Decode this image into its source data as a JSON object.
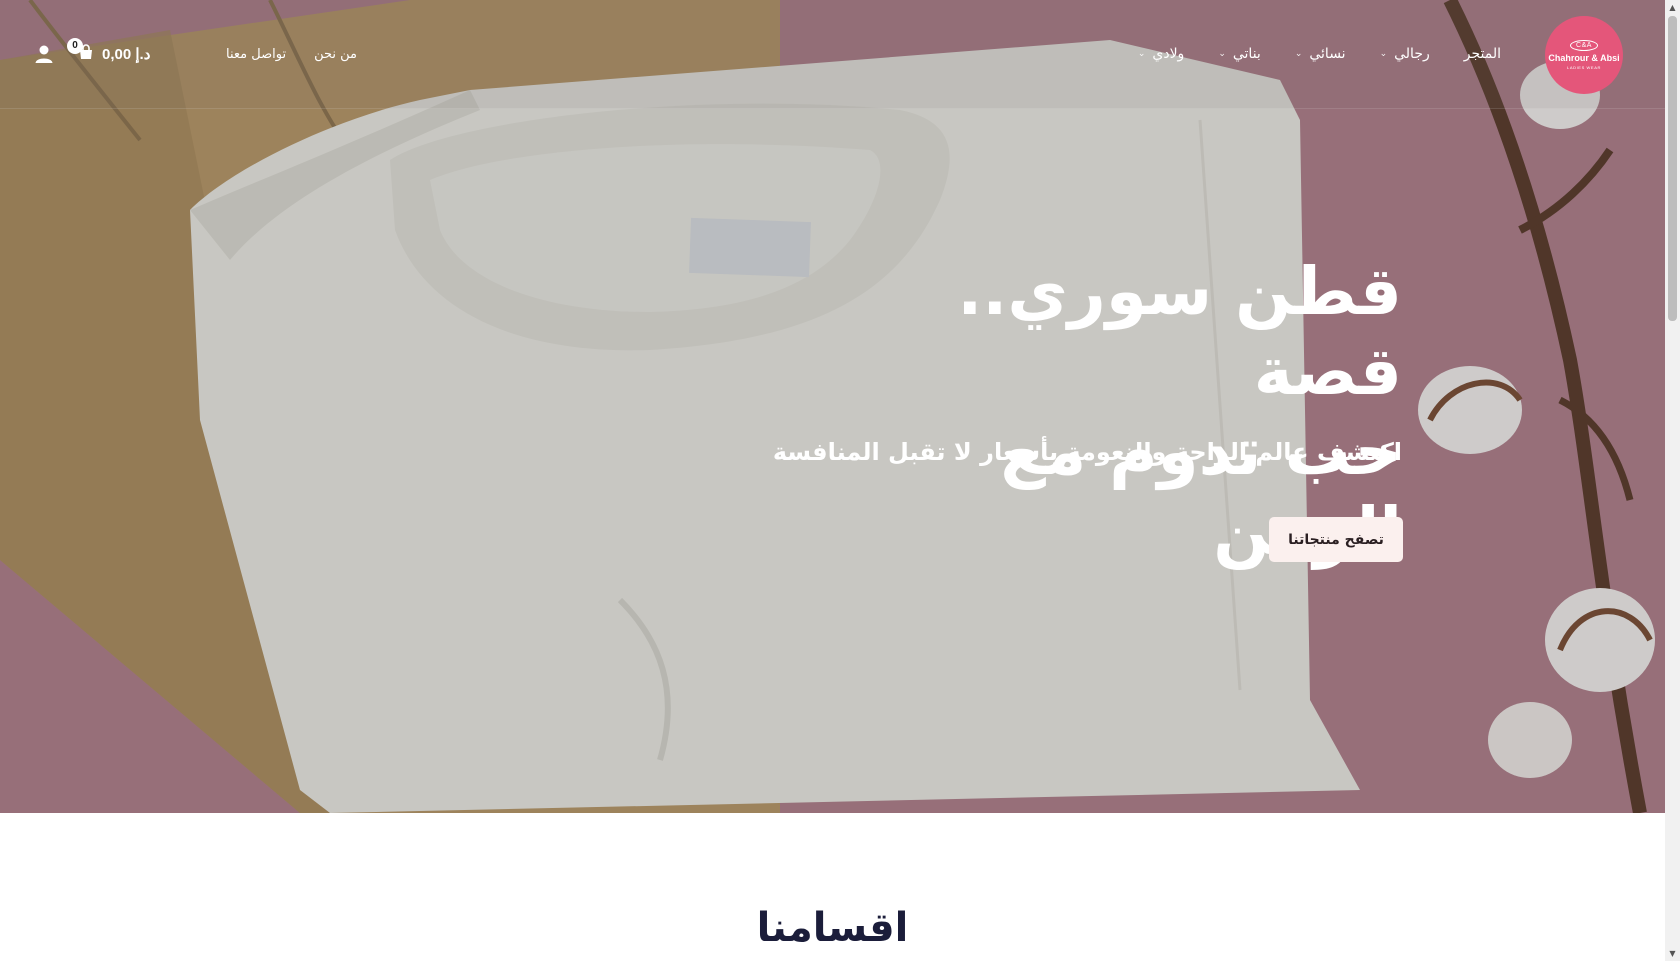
{
  "header": {
    "logo": {
      "monogram": "C&A",
      "brand": "Chahrour & Absi",
      "tagline": "LADIES WEAR"
    },
    "nav_main": [
      {
        "label": "المتجر",
        "has_dropdown": false
      },
      {
        "label": "رجالي",
        "has_dropdown": true
      },
      {
        "label": "نسائي",
        "has_dropdown": true
      },
      {
        "label": "بناتي",
        "has_dropdown": true
      },
      {
        "label": "ولادي",
        "has_dropdown": true
      }
    ],
    "nav_secondary": [
      {
        "label": "من نحن"
      },
      {
        "label": "تواصل معنا"
      }
    ],
    "cart": {
      "price": "0,00 د.إ",
      "count": "0",
      "icon": "shopping-bag-icon"
    },
    "account_icon": "user-icon"
  },
  "hero": {
    "title_line1": "قطن سوري.. قصة",
    "title_line2": "حب تدوم مع الزمن",
    "subtitle": "اكتشف عالم الراحة والنعومة بأسعار لا تقبل المنافسة",
    "cta_label": "تصفح منتجاتنا"
  },
  "sections": {
    "categories_title": "اقسامنا"
  },
  "colors": {
    "brand_pink": "#e4567a",
    "hero_background": "#a57b86",
    "button_bg": "#fbf0ee",
    "section_title": "#1b1d3a"
  }
}
